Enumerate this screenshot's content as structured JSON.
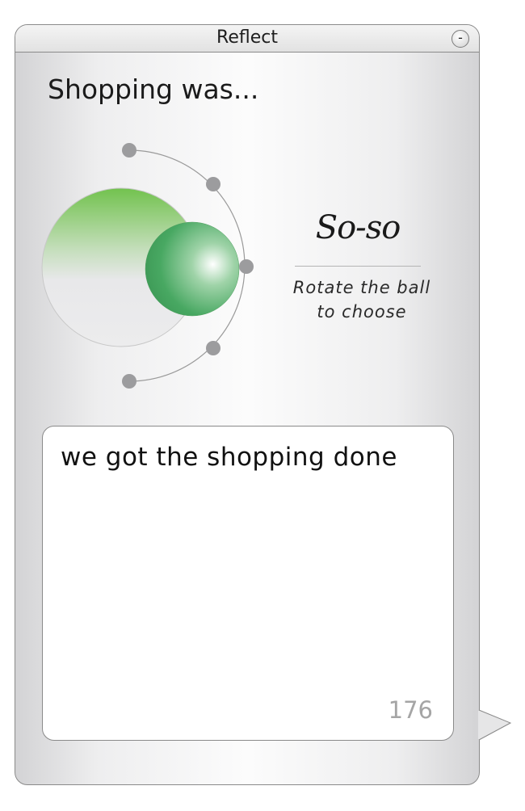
{
  "window": {
    "title": "Reflect",
    "minimize_label": "-"
  },
  "prompt": {
    "text": "Shopping was..."
  },
  "mood": {
    "selected_label": "So-so",
    "instruction_line1": "Rotate the ball",
    "instruction_line2": "to choose",
    "positions": 5,
    "selected_index": 2
  },
  "note": {
    "text": "we got the shopping done",
    "chars_remaining": "176"
  },
  "colors": {
    "accent_green": "#6fbe4c",
    "ball_green": "#4aa860",
    "dot_gray": "#9c9c9e"
  }
}
